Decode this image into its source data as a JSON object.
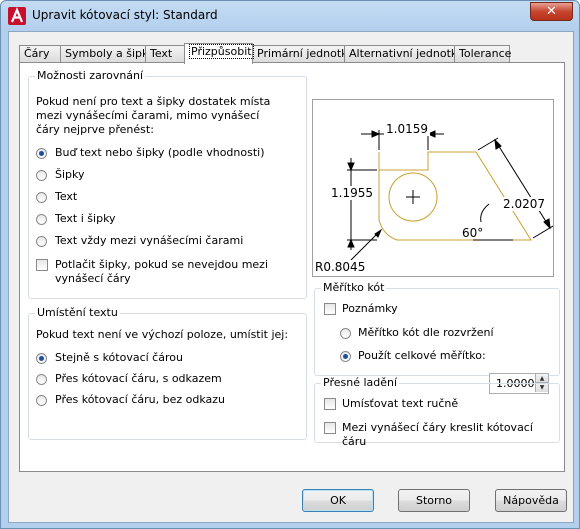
{
  "window": {
    "title": "Upravit kótovací styl: Standard",
    "close_label": "✕"
  },
  "tabs": [
    {
      "label": "Čáry"
    },
    {
      "label": "Symboly a šipky"
    },
    {
      "label": "Text"
    },
    {
      "label": "Přizpůsobit"
    },
    {
      "label": "Primární jednotky"
    },
    {
      "label": "Alternativní jednotky"
    },
    {
      "label": "Tolerance"
    }
  ],
  "fit_options": {
    "title": "Možnosti zarovnání",
    "description": "Pokud není pro text a šipky dostatek místa mezi vynášecími čarami, mimo vynášecí čáry nejprve přenést:",
    "radios": [
      {
        "label": "Buď text nebo šipky (podle vhodnosti)",
        "selected": true
      },
      {
        "label": "Šipky",
        "selected": false
      },
      {
        "label": "Text",
        "selected": false
      },
      {
        "label": "Text i šipky",
        "selected": false
      },
      {
        "label": "Text vždy mezi vynášecími čarami",
        "selected": false
      }
    ],
    "suppress_arrows": {
      "line1": "Potlačit šipky, pokud se nevejdou mezi",
      "line2": "vynášecí čáry",
      "checked": false
    }
  },
  "text_placement": {
    "title": "Umístění textu",
    "description": "Pokud text není ve výchozí poloze, umístit jej:",
    "radios": [
      {
        "label": "Stejně s kótovací čárou",
        "selected": true
      },
      {
        "label": "Přes kótovací čáru, s odkazem",
        "selected": false
      },
      {
        "label": "Přes kótovací čáru, bez odkazu",
        "selected": false
      }
    ]
  },
  "preview": {
    "labels": {
      "top": "1.0159",
      "left": "1.1955",
      "right": "2.0207",
      "angle": "60°",
      "radius": "R0.8045"
    },
    "colors": {
      "outline": "#c8a030",
      "dims": "#000000",
      "background": "#ffffff"
    }
  },
  "scale": {
    "title": "Měřítko kót",
    "annotative": {
      "label": "Poznámky",
      "checked": false
    },
    "scale_to_layout": {
      "label": "Měřítko kót dle rozvržení",
      "selected": false
    },
    "use_overall": {
      "label": "Použít celkové měřítko:",
      "selected": true,
      "value": "1.0000"
    }
  },
  "fine_tuning": {
    "title": "Přesné ladění",
    "manual_text": {
      "label": "Umísťovat text ručně",
      "checked": false
    },
    "draw_dim_line": {
      "label": "Mezi vynášecí čáry kreslit kótovací čáru",
      "checked": false
    }
  },
  "buttons": {
    "ok": "OK",
    "cancel": "Storno",
    "help": "Nápověda"
  }
}
